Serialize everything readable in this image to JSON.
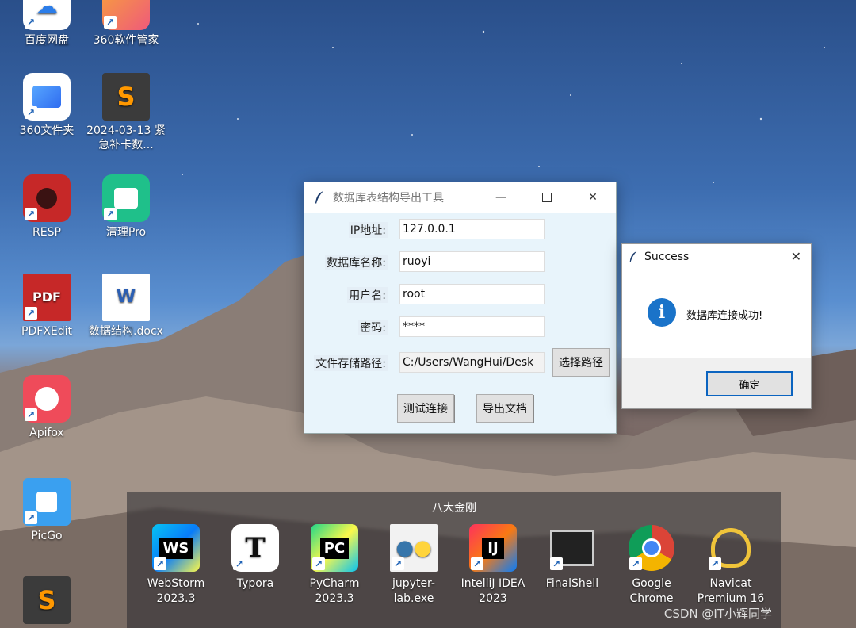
{
  "desktop": {
    "icons": [
      {
        "label": "百度网盘",
        "icon": "baidu-netdisk-icon"
      },
      {
        "label": "360软件管家",
        "icon": "360-software-icon"
      },
      {
        "label": "360文件夹",
        "icon": "360-folder-icon"
      },
      {
        "label": "2024-03-13 紧急补卡数...",
        "icon": "sublime-text-icon"
      },
      {
        "label": "RESP",
        "icon": "resp-icon"
      },
      {
        "label": "清理Pro",
        "icon": "cleaner-pro-icon"
      },
      {
        "label": "PDFXEdit",
        "icon": "pdfxedit-icon"
      },
      {
        "label": "数据结构.docx",
        "icon": "word-document-icon"
      },
      {
        "label": "Apifox",
        "icon": "apifox-icon"
      },
      {
        "label": "PicGo",
        "icon": "picgo-icon"
      }
    ]
  },
  "main_window": {
    "title": "数据库表结构导出工具",
    "fields": {
      "ip_label": "IP地址:",
      "ip_value": "127.0.0.1",
      "db_label": "数据库名称:",
      "db_value": "ruoyi",
      "user_label": "用户名:",
      "user_value": "root",
      "pwd_label": "密码:",
      "pwd_value": "****",
      "path_label": "文件存储路径:",
      "path_value": "C:/Users/WangHui/Desk"
    },
    "buttons": {
      "choose_path": "选择路径",
      "test_connection": "测试连接",
      "export_doc": "导出文档"
    }
  },
  "dialog": {
    "title": "Success",
    "message": "数据库连接成功!",
    "ok": "确定"
  },
  "taskbar_group": {
    "title": "八大金刚",
    "apps": [
      {
        "label": "WebStorm 2023.3",
        "icon": "webstorm-icon"
      },
      {
        "label": "Typora",
        "icon": "typora-icon"
      },
      {
        "label": "PyCharm 2023.3",
        "icon": "pycharm-icon"
      },
      {
        "label": "jupyter-lab.exe",
        "icon": "jupyter-icon"
      },
      {
        "label": "IntelliJ IDEA 2023",
        "icon": "intellij-icon"
      },
      {
        "label": "FinalShell",
        "icon": "finalshell-icon"
      },
      {
        "label": "Google Chrome",
        "icon": "chrome-icon"
      },
      {
        "label": "Navicat Premium 16",
        "icon": "navicat-icon"
      }
    ]
  },
  "watermark": "CSDN @IT小辉同学"
}
